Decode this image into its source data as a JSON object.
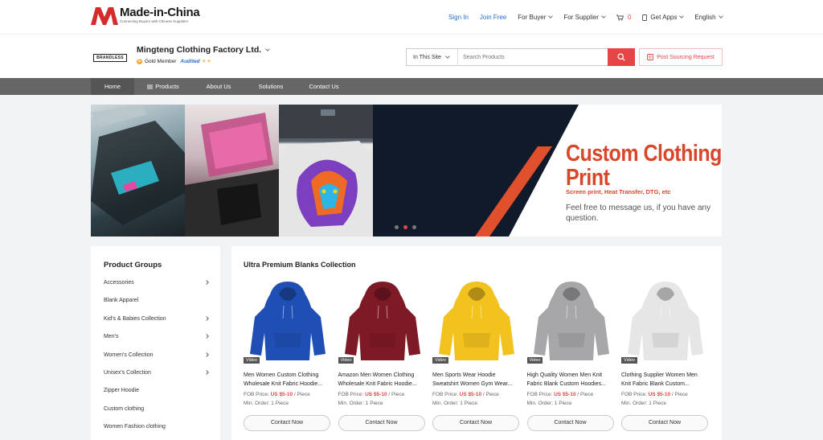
{
  "site": {
    "logo_title": "Made-in-China",
    "logo_sub": "Connecting Buyers with Chinese Suppliers"
  },
  "top_links": {
    "sign_in": "Sign In",
    "join_free": "Join Free",
    "for_buyer": "For Buyer",
    "for_supplier": "For Supplier",
    "cart_count": "0",
    "get_apps": "Get Apps",
    "language": "English"
  },
  "supplier": {
    "brand_logo": "BRANDLESS",
    "name": "Mingteng Clothing Factory Ltd.",
    "member": "Gold Member",
    "audited": "Audited"
  },
  "search": {
    "scope": "In This Site",
    "placeholder": "Search Products",
    "post_label": "Post Sourcing Request"
  },
  "nav": {
    "items": [
      "Home",
      "Products",
      "About Us",
      "Solutions",
      "Contact Us"
    ]
  },
  "banner": {
    "title_line1": "Custom Clothing",
    "title_line2": "Print",
    "subtitle": "Screen print, Heat Transfer, DTG, etc",
    "message": "Feel free to message us, if you have any question.",
    "active_slide": 2,
    "slide_count": 3
  },
  "groups": {
    "title": "Product Groups",
    "items": [
      {
        "label": "Accessories",
        "has_children": true
      },
      {
        "label": "Blank Apparel",
        "has_children": false
      },
      {
        "label": "Kid's & Babies Collection",
        "has_children": true
      },
      {
        "label": "Men's",
        "has_children": true
      },
      {
        "label": "Women's Collection",
        "has_children": true
      },
      {
        "label": "Unisex's Collection",
        "has_children": true
      },
      {
        "label": "Zipper Hoodie",
        "has_children": false
      },
      {
        "label": "Custom clothing",
        "has_children": false
      },
      {
        "label": "Women Fashion clothing",
        "has_children": false
      }
    ]
  },
  "collection": {
    "title": "Ultra Premium Blanks Collection",
    "price_label": "FOB Price:",
    "price_unit": "/ Piece",
    "contact_label": "Contact Now",
    "video_label": "Video",
    "products": [
      {
        "name_line1": "Men Women Custom Clothing",
        "name_line2": "Wholesale Knit Fabric Hoodie...",
        "price": "US $5-10",
        "moq": "Min. Order: 1 Piece",
        "color": "#1f4fb5"
      },
      {
        "name_line1": "Amazon Men Women Clothing",
        "name_line2": "Wholesale Knit Fabric Hoodie...",
        "price": "US $5-10",
        "moq": "Min. Order: 1 Piece",
        "color": "#7e1a26"
      },
      {
        "name_line1": "Men Sports Wear Hoodie",
        "name_line2": "Sweatshirt Women Gym Wear...",
        "price": "US $5-10",
        "moq": "Min. Order: 1 Piece",
        "color": "#f2c21f"
      },
      {
        "name_line1": "High Quality Women Men Knit",
        "name_line2": "Fabric Blank Custom Hoodies...",
        "price": "US $5-10",
        "moq": "Min. Order: 1 Piece",
        "color": "#a7a7a9"
      },
      {
        "name_line1": "Clothing Supplier Women Men",
        "name_line2": "Knit Fabric Blank Custom...",
        "price": "US $5-10",
        "moq": "Min. Order: 1 Piece",
        "color": "#e6e6e6"
      }
    ]
  },
  "colors": {
    "accent": "#e64545",
    "link": "#2a6cc9",
    "nav_bg": "#666666",
    "banner_title": "#d9472b"
  }
}
